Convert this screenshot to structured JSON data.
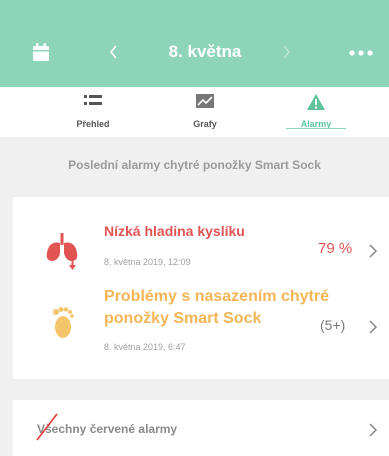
{
  "header": {
    "date": "8. května",
    "calendar_icon": "calendar-icon",
    "back_icon": "chevron-left-icon",
    "forward_icon": "chevron-right-icon",
    "more_icon": "more-dots-icon",
    "background_color": "#8dd4b8"
  },
  "tabs": [
    {
      "label": "Přehled",
      "icon": "list-icon",
      "active": false
    },
    {
      "label": "Grafy",
      "icon": "chart-icon",
      "active": false
    },
    {
      "label": "Alarmy",
      "icon": "warning-icon",
      "active": true
    }
  ],
  "section_title": "Poslední alarmy chytré ponožky Smart Sock",
  "alarms": [
    {
      "title": "Nízká hladina kyslíku",
      "timestamp": "8. května 2019, 12:09",
      "value": "79 %",
      "icon": "lungs-icon",
      "color": "#e25454"
    },
    {
      "title": "Problémy s nasazením chytré ponožky Smart Sock",
      "timestamp": "8. května 2019, 6:47",
      "count": "(5+)",
      "icon": "foot-icon",
      "color": "#f3b556"
    }
  ],
  "footer": {
    "label": "Všechny červené alarmy"
  }
}
